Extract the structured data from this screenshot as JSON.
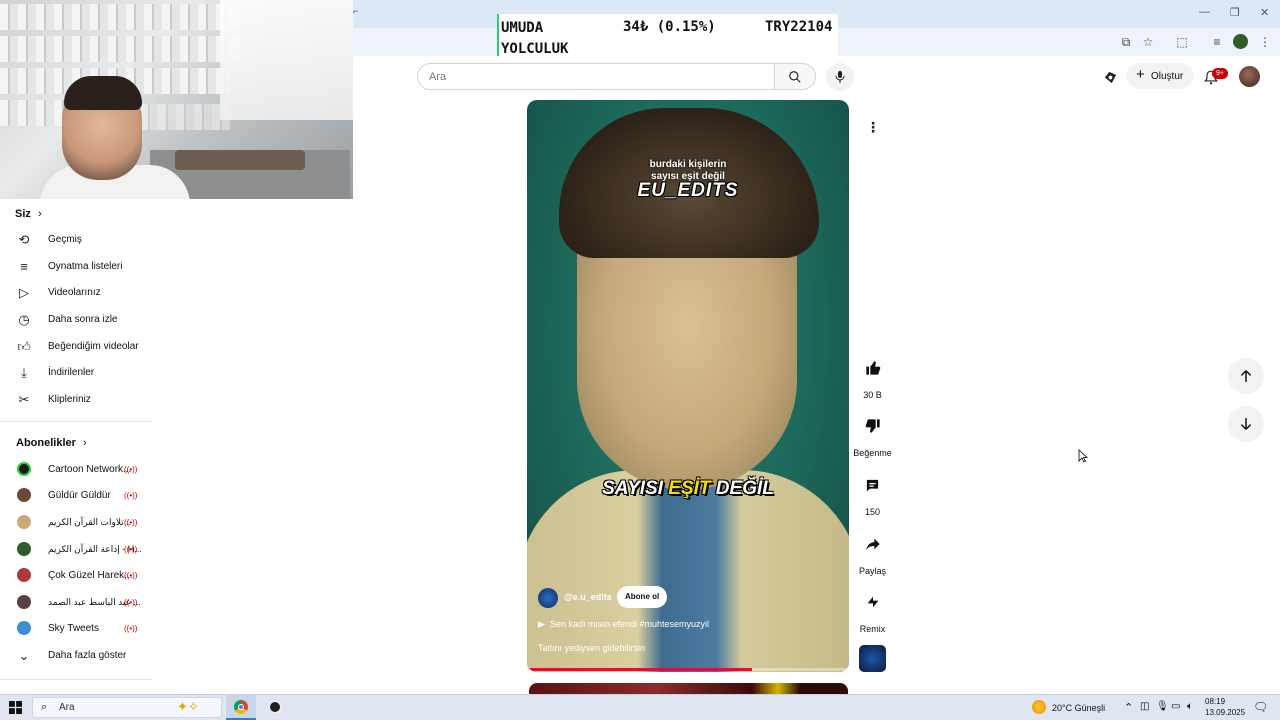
{
  "ticker": {
    "name": "UMUDA YOLCULUK",
    "price": "34₺ (0.15%)",
    "code": "TRY22104"
  },
  "search": {
    "placeholder": "Ara"
  },
  "header": {
    "create_label": "Oluştur",
    "notif_count": "9+"
  },
  "sidebar": {
    "you_heading": "Siz",
    "you_items": [
      {
        "label": "Geçmiş",
        "icon": "history-icon"
      },
      {
        "label": "Oynatma listeleri",
        "icon": "playlist-icon"
      },
      {
        "label": "Videolarınız",
        "icon": "your-videos-icon"
      },
      {
        "label": "Daha sonra izle",
        "icon": "watch-later-icon"
      },
      {
        "label": "Beğendiğim videolar",
        "icon": "liked-icon"
      },
      {
        "label": "İndirilenler",
        "icon": "download-icon"
      },
      {
        "label": "Klipleriniz",
        "icon": "clips-icon"
      }
    ],
    "subs_heading": "Abonelikler",
    "subscriptions": [
      {
        "label": "Cartoon Network...",
        "avatar_color": "#1a1a1a"
      },
      {
        "label": "Güldür Güldür",
        "avatar_color": "#6b4a3a"
      },
      {
        "label": "تلاوات القرآن الكريم...",
        "avatar_color": "#c9a978"
      },
      {
        "label": "إذاعة القرآن الكريم - H...",
        "avatar_color": "#2f5d2a"
      },
      {
        "label": "Çok Güzel Harek...",
        "avatar_color": "#b03a3a"
      },
      {
        "label": "عبد الباسط عبد الصمد ...",
        "avatar_color": "#5a4040"
      },
      {
        "label": "Sky Tweets",
        "avatar_color": "#3f8fd6"
      }
    ],
    "show_more": "Daha fazla göster"
  },
  "video": {
    "caption_line1": "burdaki kişilerin",
    "caption_line2": "sayısı eşit değil",
    "brand": "EU_EDITS",
    "subtitle_a": "SAYISI ",
    "subtitle_b": "EŞİT",
    "subtitle_c": " DEĞİL",
    "channel": "@e.u_edits",
    "subscribe": "Abone ol",
    "music": "Sen kadı mısın efendi #muhtesemyuzyil",
    "title": "Tatlını yediysen gidebilirsin",
    "progress": 0.7
  },
  "actions": {
    "like_count": "30 B",
    "dislike_label": "Beğenme",
    "comment_count": "150",
    "share_label": "Paylaş",
    "remix_label": "Remix"
  },
  "taskbar": {
    "search_placeholder": "Ara",
    "weather": "20°C Güneşli",
    "time": "08:19",
    "date": "13.09.2025"
  },
  "colors": {
    "accent_red": "#ff0033",
    "ticker_green": "#2ecc71"
  }
}
